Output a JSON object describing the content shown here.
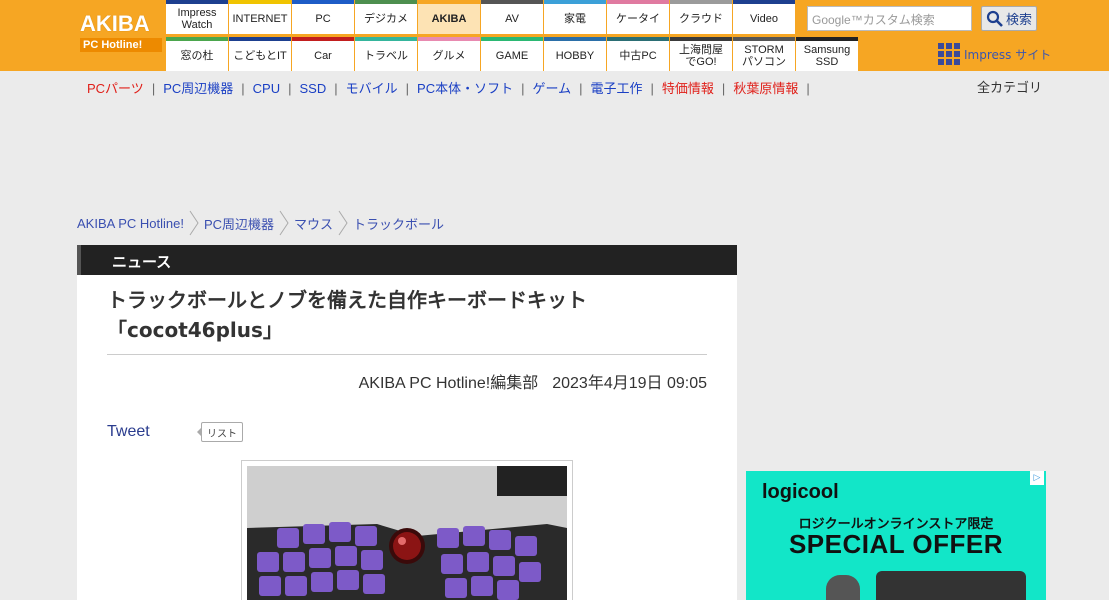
{
  "logo": {
    "line1": "AKIBA",
    "line2": "PC Hotline!"
  },
  "nav_top": [
    {
      "label": "Impress\nWatch",
      "color": "#1d3f8f"
    },
    {
      "label": "INTERNET",
      "color": "#f0c400"
    },
    {
      "label": "PC",
      "color": "#1d5cc7"
    },
    {
      "label": "デジカメ",
      "color": "#4d8f4f"
    },
    {
      "label": "AKIBA",
      "color": "#f6a623",
      "active": true
    },
    {
      "label": "AV",
      "color": "#555555"
    },
    {
      "label": "家電",
      "color": "#3ba0d8"
    },
    {
      "label": "ケータイ",
      "color": "#e07aa0"
    },
    {
      "label": "クラウド",
      "color": "#9b9b9b"
    },
    {
      "label": "Video",
      "color": "#1d3f8f"
    }
  ],
  "nav_bottom": [
    {
      "label": "窓の杜",
      "color": "#4ba64d"
    },
    {
      "label": "こどもとIT",
      "color": "#1d3f8f"
    },
    {
      "label": "Car",
      "color": "#c21e1e"
    },
    {
      "label": "トラベル",
      "color": "#35b59c"
    },
    {
      "label": "グルメ",
      "color": "#e88ab0"
    },
    {
      "label": "GAME",
      "color": "#2bb873"
    },
    {
      "label": "HOBBY",
      "color": "#2b6fa8"
    },
    {
      "label": "中古PC",
      "color": "#2b6e74"
    },
    {
      "label": "上海問屋\nでGO!",
      "color": "#3a3a3a"
    },
    {
      "label": "STORM\nパソコン",
      "color": "#555555"
    },
    {
      "label": "Samsung\nSSD",
      "color": "#222222"
    }
  ],
  "search": {
    "placeholder": "Google™カスタム検索",
    "button_label": "検索"
  },
  "impress_site": "Impress サイト",
  "category_nav": [
    {
      "label": "PCパーツ",
      "red": true
    },
    {
      "label": "PC周辺機器"
    },
    {
      "label": "CPU"
    },
    {
      "label": "SSD"
    },
    {
      "label": "モバイル"
    },
    {
      "label": "PC本体・ソフト"
    },
    {
      "label": "ゲーム"
    },
    {
      "label": "電子工作"
    },
    {
      "label": "特価情報",
      "red": true
    },
    {
      "label": "秋葉原情報",
      "red": true
    }
  ],
  "all_categories": "全カテゴリ",
  "breadcrumb": [
    "AKIBA PC Hotline!",
    "PC周辺機器",
    "マウス",
    "トラックボール"
  ],
  "article": {
    "section": "ニュース",
    "title_line1": "トラックボールとノブを備えた自作キーボードキット",
    "title_line2": "「cocot46plus」",
    "author": "AKIBA PC Hotline!編集部",
    "date": "2023年4月19日 09:05",
    "tweet": "Tweet",
    "list": "リスト"
  },
  "ad": {
    "brand": "logicool",
    "subtitle": "ロジクールオンラインストア限定",
    "offer": "SPECIAL OFFER",
    "bg_color": "#12e6c8"
  }
}
